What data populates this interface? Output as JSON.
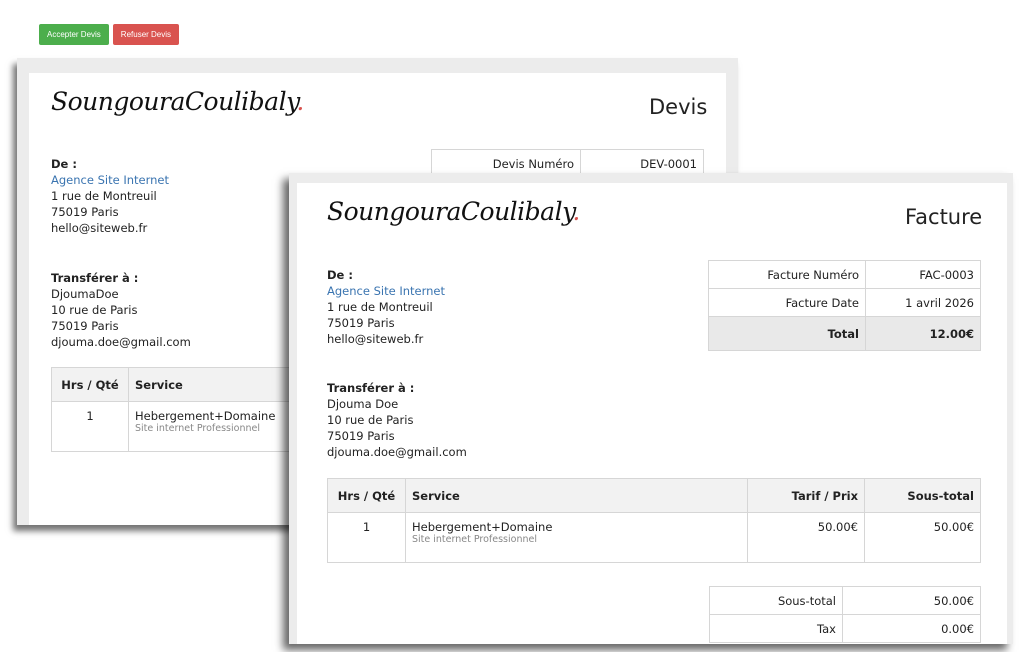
{
  "actions": {
    "accept_label": "Accepter Devis",
    "refuse_label": "Refuser Devis"
  },
  "devis": {
    "logo": "SoungouraCoulibaly",
    "title": "Devis",
    "from_label": "De :",
    "from_company": "Agence Site Internet",
    "from_street": "1 rue de Montreuil",
    "from_city": "75019 Paris",
    "from_email": "hello@siteweb.fr",
    "to_label": "Transférer à :",
    "to_name": "DjoumaDoe",
    "to_street": "10 rue de Paris",
    "to_city": "75019 Paris",
    "to_email": "djouma.doe@gmail.com",
    "number_label": "Devis Numéro",
    "number_value": "DEV-0001",
    "col_qty": "Hrs / Qté",
    "col_service": "Service",
    "item_qty": "1",
    "item_name": "Hebergement+Domaine",
    "item_desc": "Site internet Professionnel"
  },
  "facture": {
    "logo": "SoungouraCoulibaly",
    "title": "Facture",
    "from_label": "De :",
    "from_company": "Agence Site Internet",
    "from_street": "1 rue de Montreuil",
    "from_city": "75019 Paris",
    "from_email": "hello@siteweb.fr",
    "to_label": "Transférer à :",
    "to_name": "Djouma Doe",
    "to_street": "10 rue de Paris",
    "to_city": "75019 Paris",
    "to_email": "djouma.doe@gmail.com",
    "number_label": "Facture Numéro",
    "number_value": "FAC-0003",
    "date_label": "Facture Date",
    "date_value": "1 avril 2026",
    "total_label": "Total",
    "total_value": "12.00€",
    "col_qty": "Hrs / Qté",
    "col_service": "Service",
    "col_price": "Tarif / Prix",
    "col_subtotal": "Sous-total",
    "item_qty": "1",
    "item_name": "Hebergement+Domaine",
    "item_desc": "Site internet Professionnel",
    "item_price": "50.00€",
    "item_subtotal": "50.00€",
    "subtotal_label": "Sous-total",
    "subtotal_value": "50.00€",
    "tax_label": "Tax",
    "tax_value": "0.00€"
  },
  "colors": {
    "accept": "#4cae4c",
    "refuse": "#d9534f",
    "link": "#3a74b0"
  }
}
